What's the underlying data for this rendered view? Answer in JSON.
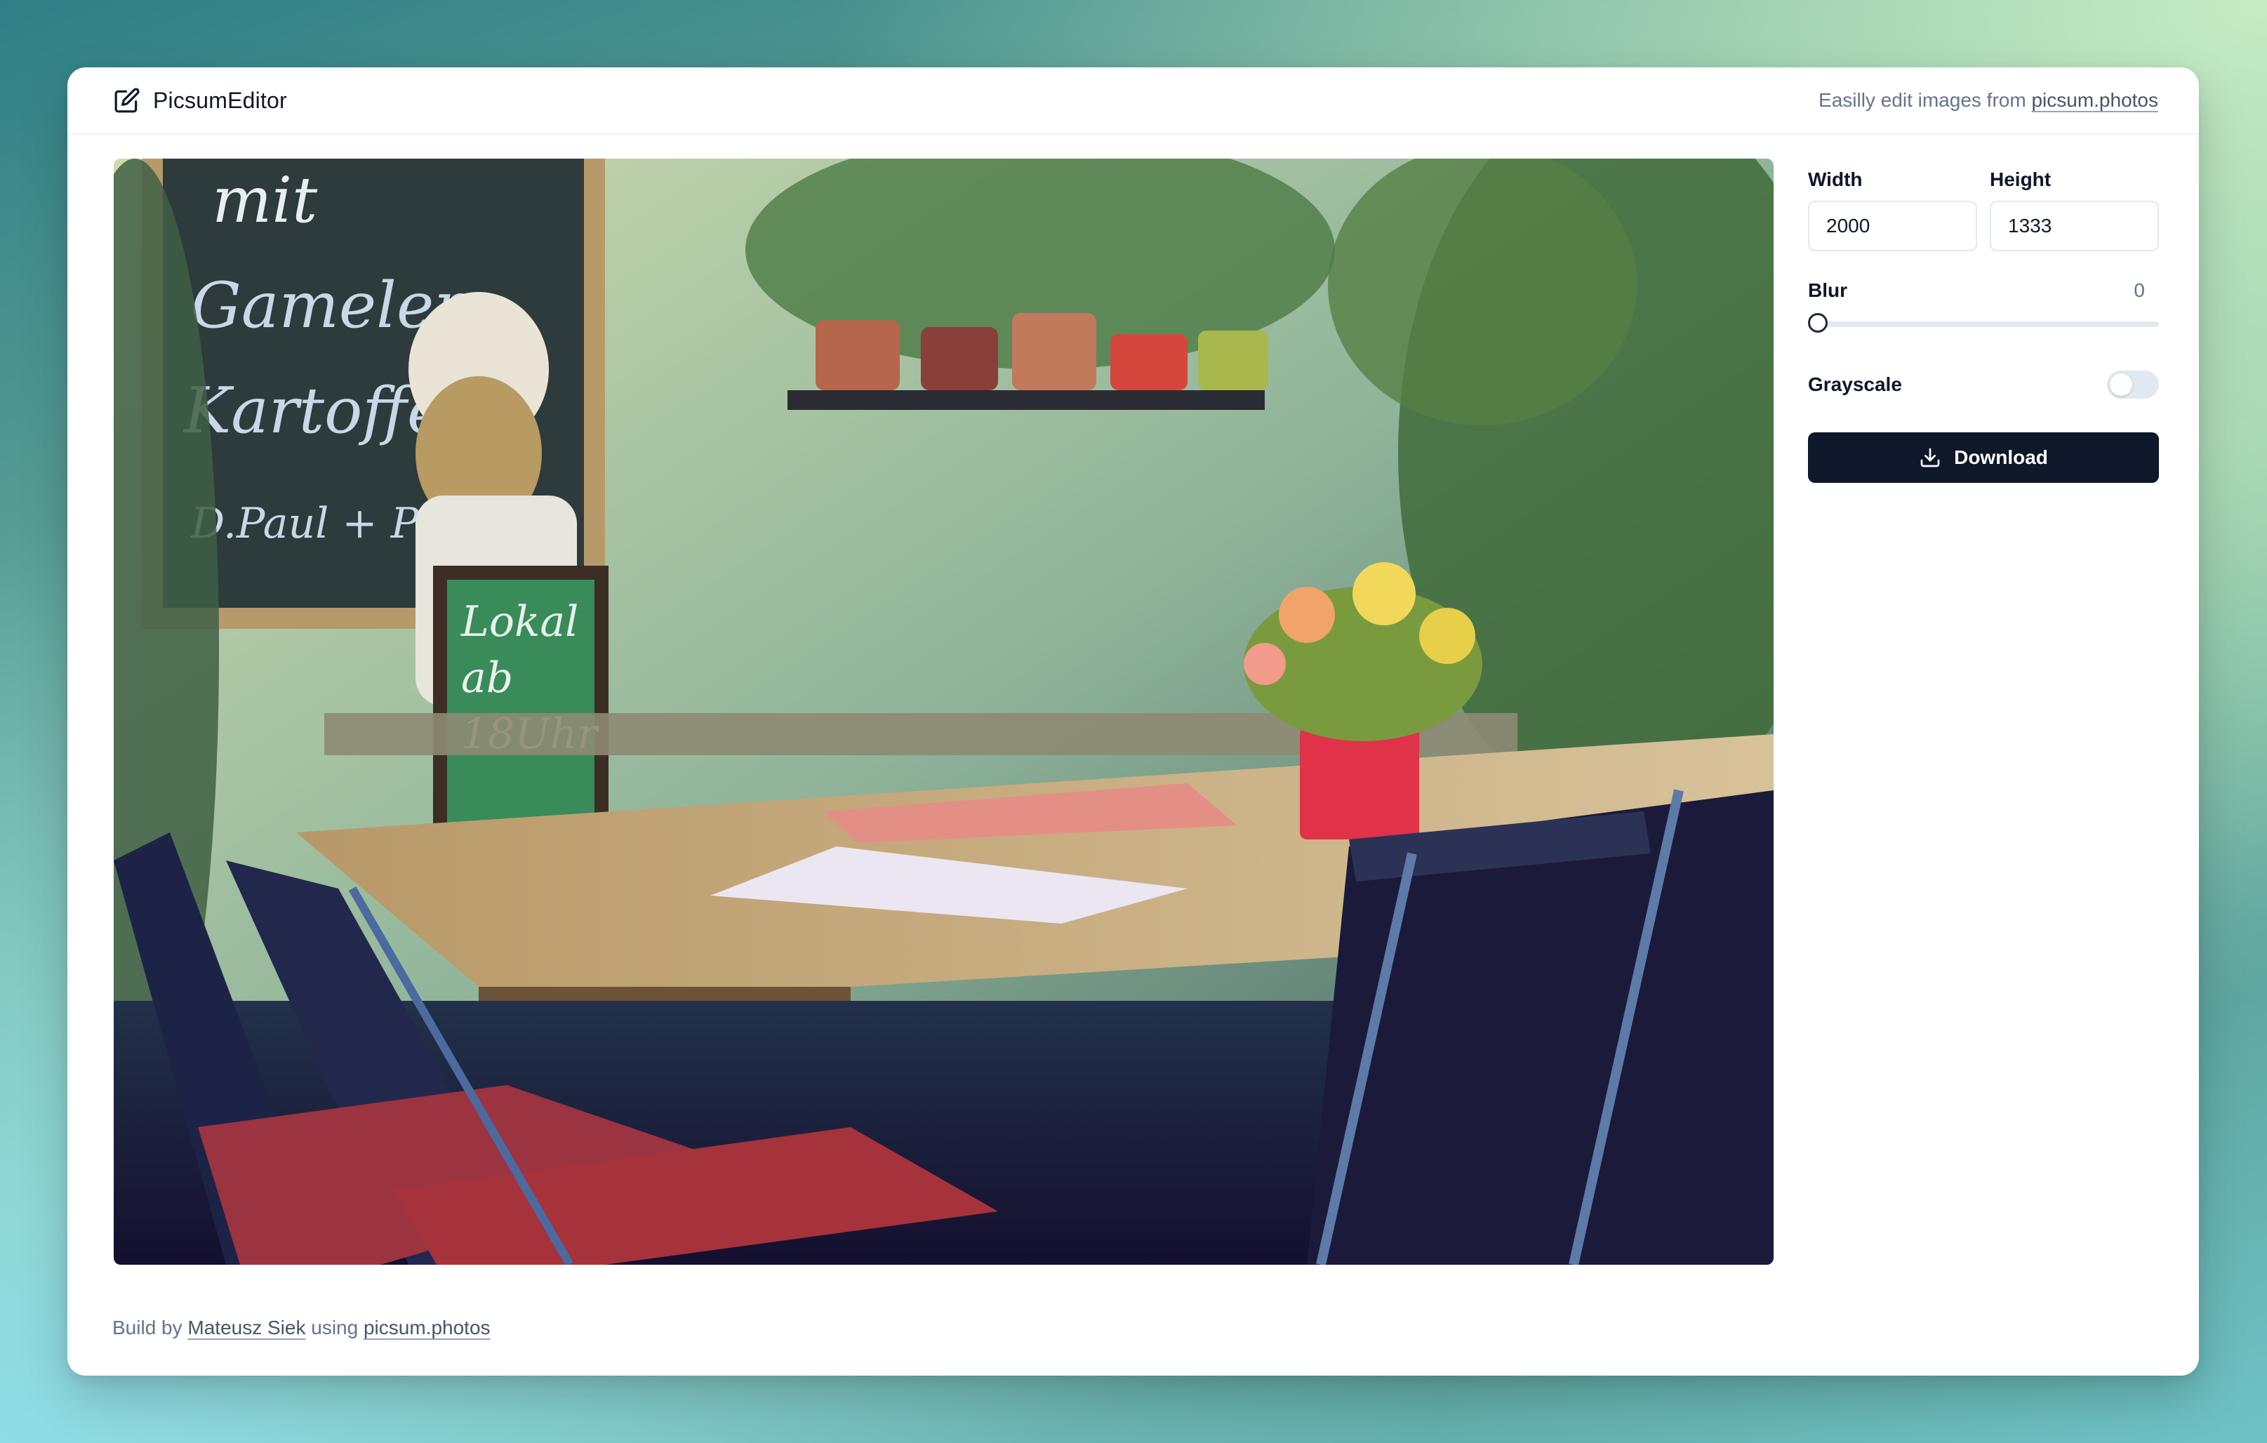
{
  "header": {
    "app_name": "PicsumEditor",
    "brand_icon": "edit-square-icon",
    "tagline_prefix": "Easilly edit images from",
    "tagline_link": "picsum.photos"
  },
  "controls": {
    "width_label": "Width",
    "width_value": "2000",
    "height_label": "Height",
    "height_value": "1333",
    "blur_label": "Blur",
    "blur_value": "0",
    "grayscale_label": "Grayscale",
    "grayscale_on": false,
    "download_label": "Download",
    "download_icon": "download-icon"
  },
  "footer": {
    "prefix": "Build by",
    "author": "Mateusz Siek",
    "middle": "using",
    "link": "picsum.photos"
  },
  "colors": {
    "primary": "#0f172a",
    "muted": "#64748b",
    "border": "#e2e8f0"
  }
}
